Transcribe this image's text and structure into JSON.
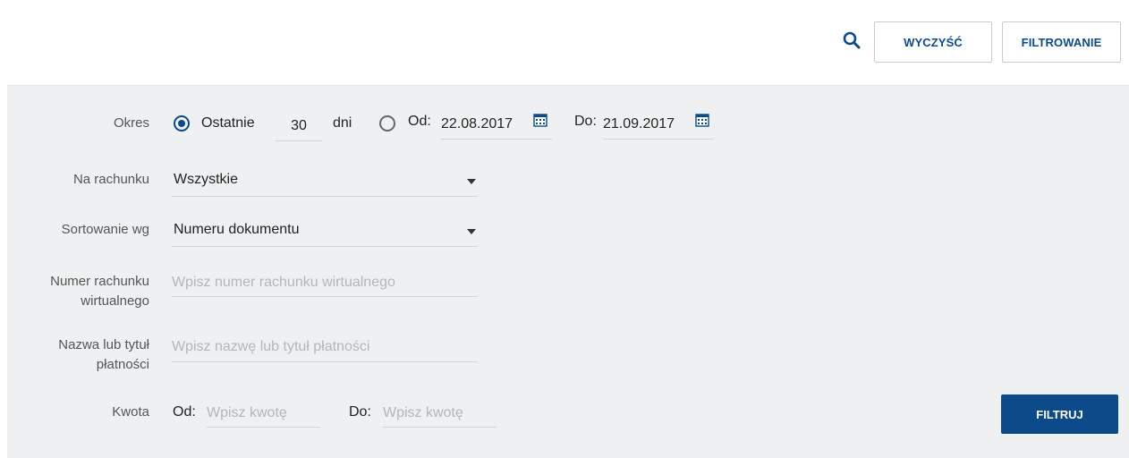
{
  "toolbar": {
    "search_icon": "search-icon",
    "clear_label": "WYCZYŚĆ",
    "filter_label": "FILTROWANIE"
  },
  "form": {
    "period": {
      "label": "Okres",
      "last_label": "Ostatnie",
      "last_days": "30",
      "days_label": "dni",
      "from_label": "Od:",
      "from_date": "22.08.2017",
      "to_label": "Do:",
      "to_date": "21.09.2017",
      "selected": "last"
    },
    "account": {
      "label": "Na rachunku",
      "value": "Wszystkie"
    },
    "sort": {
      "label": "Sortowanie wg",
      "value": "Numeru dokumentu"
    },
    "virtual_account": {
      "label_line1": "Numer rachunku",
      "label_line2": "wirtualnego",
      "placeholder": "Wpisz numer rachunku wirtualnego"
    },
    "payment_title": {
      "label_line1": "Nazwa lub tytuł",
      "label_line2": "płatności",
      "placeholder": "Wpisz nazwę lub tytuł płatności"
    },
    "amount": {
      "label": "Kwota",
      "from_label": "Od:",
      "from_placeholder": "Wpisz kwotę",
      "to_label": "Do:",
      "to_placeholder": "Wpisz kwotę"
    },
    "submit_label": "FILTRUJ"
  },
  "colors": {
    "accent": "#0d4a8a",
    "panel_bg": "#eff0f1"
  }
}
